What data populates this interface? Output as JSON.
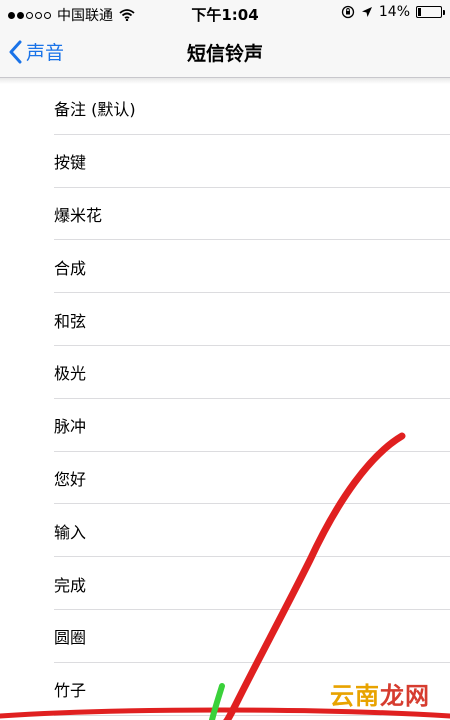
{
  "status_bar": {
    "carrier": "中国联通",
    "time": "下午1:04",
    "battery_percent": "14%",
    "battery_level": 0.14,
    "signal_filled": 2,
    "signal_total": 5,
    "icons": [
      "wifi-icon",
      "orientation-lock-icon",
      "location-arrow-icon",
      "battery-icon"
    ]
  },
  "nav": {
    "back_label": "声音",
    "title": "短信铃声"
  },
  "tones": [
    {
      "label": "备注 (默认)"
    },
    {
      "label": "按键"
    },
    {
      "label": "爆米花"
    },
    {
      "label": "合成"
    },
    {
      "label": "和弦"
    },
    {
      "label": "极光"
    },
    {
      "label": "脉冲"
    },
    {
      "label": "您好"
    },
    {
      "label": "输入"
    },
    {
      "label": "完成"
    },
    {
      "label": "圆圈"
    },
    {
      "label": "竹子"
    }
  ],
  "annotation": {
    "stroke_color_red": "#e02020",
    "stroke_color_green": "#3ad13a"
  },
  "watermark": {
    "text_main": "云南",
    "text_accent": "龙网"
  },
  "colors": {
    "accent": "#1a73e8"
  }
}
